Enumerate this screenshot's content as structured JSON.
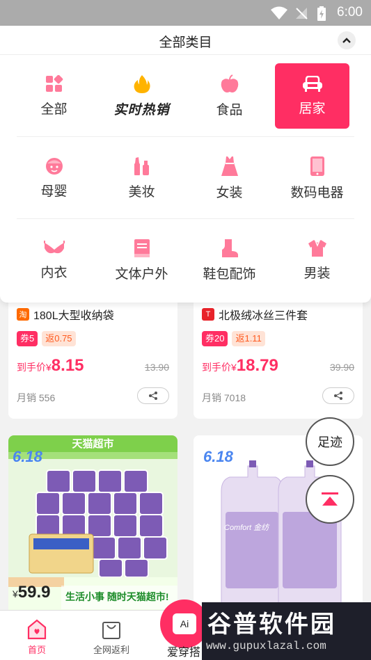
{
  "status_bar": {
    "time": "6:00"
  },
  "dropdown": {
    "title": "全部类目",
    "categories": [
      {
        "label": "全部",
        "icon": "grid-icon"
      },
      {
        "label": "实时热销",
        "icon": "flame-icon"
      },
      {
        "label": "食品",
        "icon": "apple-icon"
      },
      {
        "label": "居家",
        "icon": "sofa-icon",
        "active": true
      },
      {
        "label": "母婴",
        "icon": "baby-icon"
      },
      {
        "label": "美妆",
        "icon": "cosmetics-icon"
      },
      {
        "label": "女装",
        "icon": "dress-icon"
      },
      {
        "label": "数码电器",
        "icon": "phone-icon"
      },
      {
        "label": "内衣",
        "icon": "bra-icon"
      },
      {
        "label": "文体户外",
        "icon": "book-icon"
      },
      {
        "label": "鞋包配饰",
        "icon": "boot-icon"
      },
      {
        "label": "男装",
        "icon": "shirt-icon"
      }
    ]
  },
  "products": [
    {
      "source_badge": "淘",
      "title": "180L大型收纳袋",
      "coupon": "券5",
      "rebate": "返0.75",
      "price_label": "到手价¥",
      "price": "8.15",
      "original_price": "13.90",
      "sales": "月销 556"
    },
    {
      "source_badge": "T",
      "title": "北极绒冰丝三件套",
      "coupon": "券20",
      "rebate": "返1.11",
      "price_label": "到手价¥",
      "price": "18.79",
      "original_price": "39.90",
      "sales": "月销 7018"
    }
  ],
  "image_cards": {
    "left": {
      "banner": "天猫超市",
      "badge": "6.18",
      "promo_price_prefix": "¥",
      "promo_price": "59.9",
      "promo_slogan": "生活小事 随时天猫超市!"
    },
    "right": {
      "badge": "6.18",
      "brand": "Comfort 金纺"
    }
  },
  "floating": {
    "footprint": "足迹"
  },
  "bottom_nav": {
    "home": "首页",
    "rebate": "全网返利",
    "ai_icon": "Ai",
    "ai_label": "爱穿搭"
  },
  "watermark": {
    "line1": "谷普软件园",
    "line2": "www.gupuxlazal.com"
  },
  "colors": {
    "accent": "#ff2e63",
    "category_icon": "#ff7a9a"
  }
}
